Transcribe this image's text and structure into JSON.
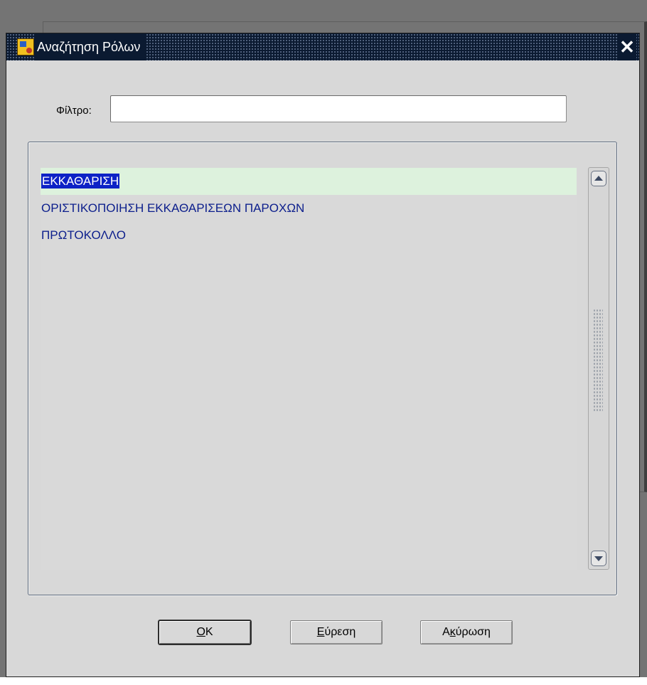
{
  "dialog": {
    "title": "Αναζήτηση Ρόλων",
    "close_glyph": "✕"
  },
  "filter": {
    "label": "Φίλτρο:",
    "value": "",
    "placeholder": ""
  },
  "list": {
    "items": [
      {
        "label": "ΕΚΚΑΘΑΡΙΣΗ",
        "selected": true
      },
      {
        "label": "ΟΡΙΣΤΙΚΟΠΟΙΗΣΗ ΕΚΚΑΘΑΡΙΣΕΩΝ ΠΑΡΟΧΩΝ",
        "selected": false
      },
      {
        "label": "ΠΡΩΤΟΚΟΛΛΟ",
        "selected": false
      }
    ]
  },
  "buttons": {
    "ok": {
      "mnemonic": "O",
      "rest": "K"
    },
    "find": {
      "mnemonic": "Ε",
      "rest": "ύρεση"
    },
    "cancel": {
      "before": "Α",
      "mnemonic": "κ",
      "rest": "ύρωση"
    }
  },
  "icons": [
    "app-icon",
    "close-icon",
    "scroll-up-icon",
    "scroll-down-icon"
  ],
  "colors": {
    "titlebar": "#0b1a31",
    "selection": "#0d22c6",
    "row_highlight": "#ddf2dd",
    "item_text": "#0c1e8c",
    "dialog_bg": "#d8d8d8"
  }
}
